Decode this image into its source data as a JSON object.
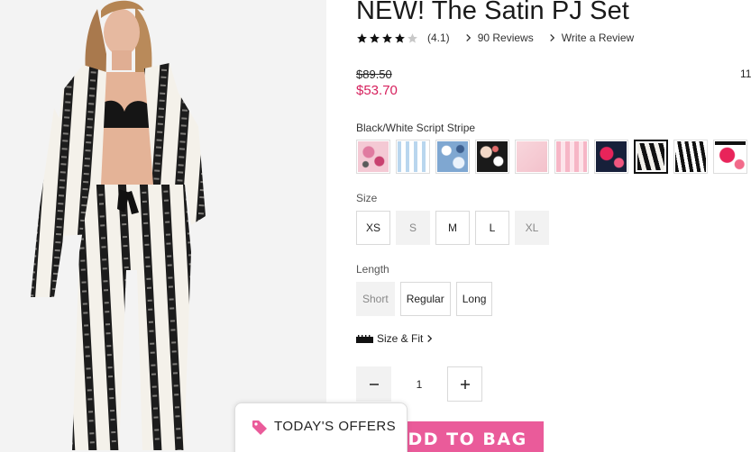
{
  "product": {
    "image_alt": "Model wearing black and white script stripe satin pajama set",
    "title": "NEW! The Satin PJ Set",
    "rating": {
      "stars": 4.1,
      "value_text": "(4.1)",
      "reviews_link": "90 Reviews",
      "write_review_link": "Write a Review"
    },
    "price": {
      "original": "$89.50",
      "sale": "$53.70",
      "side_number": "11"
    },
    "color": {
      "selected_name": "Black/White Script Stripe",
      "swatches": [
        {
          "name": "pink-floral",
          "selected": false
        },
        {
          "name": "blue-stripe",
          "selected": false
        },
        {
          "name": "blue-floral",
          "selected": false
        },
        {
          "name": "black-floral",
          "selected": false
        },
        {
          "name": "pink-solid",
          "selected": false
        },
        {
          "name": "pink-stripe",
          "selected": false
        },
        {
          "name": "navy-red-floral",
          "selected": false
        },
        {
          "name": "black-white-script-stripe",
          "selected": true
        },
        {
          "name": "black-white-stripe",
          "selected": false
        },
        {
          "name": "red-floral",
          "selected": false
        }
      ]
    },
    "size": {
      "label": "Size",
      "options": [
        {
          "label": "XS",
          "available": true
        },
        {
          "label": "S",
          "available": false
        },
        {
          "label": "M",
          "available": true
        },
        {
          "label": "L",
          "available": true
        },
        {
          "label": "XL",
          "available": false
        }
      ]
    },
    "length": {
      "label": "Length",
      "options": [
        {
          "label": "Short",
          "available": false
        },
        {
          "label": "Regular",
          "available": true
        },
        {
          "label": "Long",
          "available": true
        }
      ]
    },
    "size_fit_link": "Size & Fit",
    "quantity": "1",
    "add_to_bag": "ADD TO BAG"
  },
  "offers": {
    "label": "TODAY'S OFFERS"
  },
  "colors": {
    "sale_price": "#d6205d",
    "add_to_bag_bg": "#ea5b9a",
    "text": "#222222"
  }
}
